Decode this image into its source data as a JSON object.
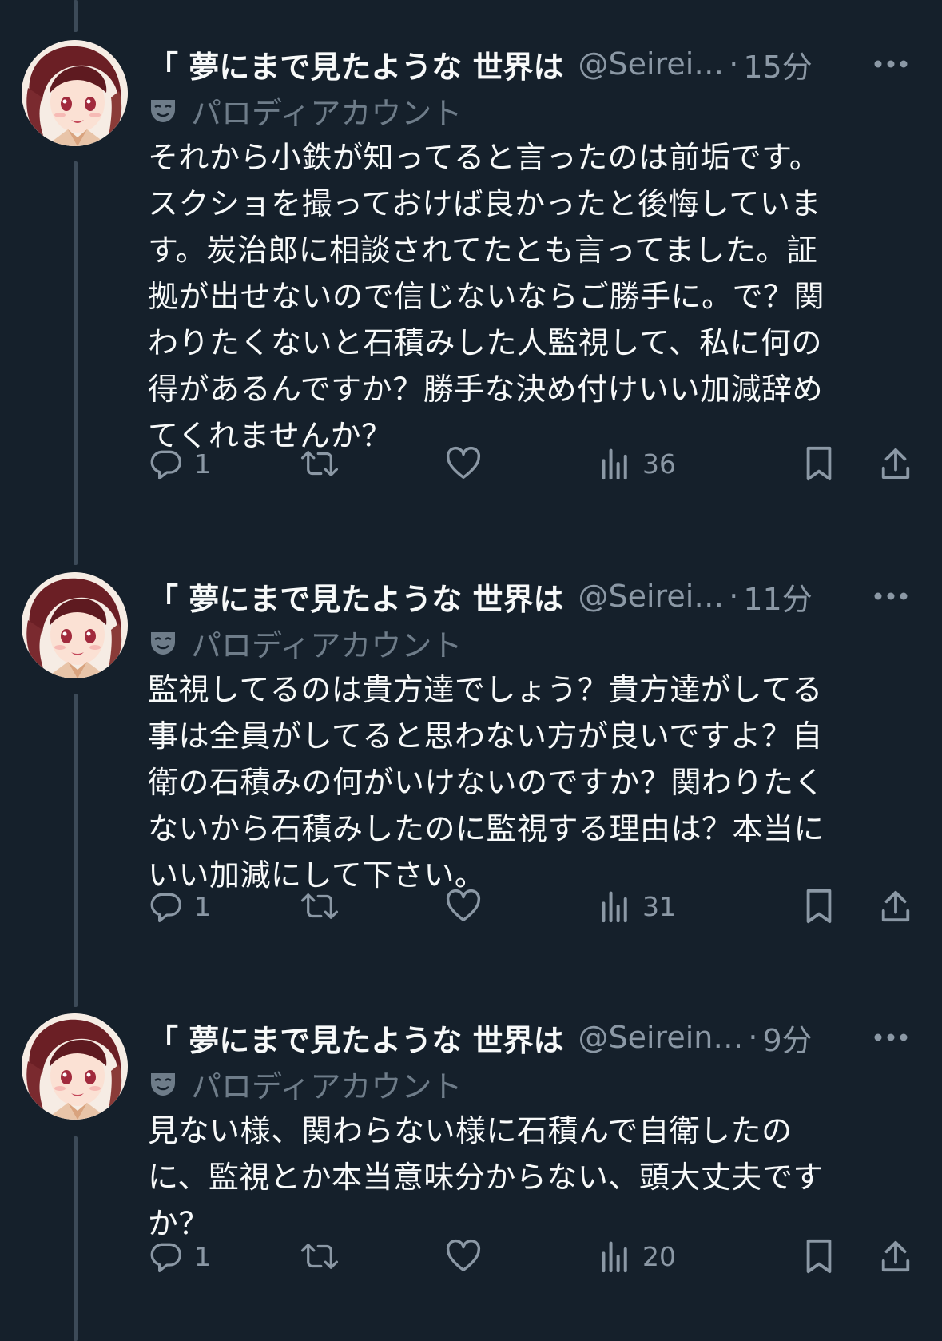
{
  "colors": {
    "background": "#15202b",
    "text_primary": "#f7f9f9",
    "text_secondary": "#8b98a5",
    "thread_line": "#3c4a58"
  },
  "tweets": [
    {
      "name": "「 夢にまで見たような 世界は",
      "handle": "@Seirei…",
      "sep": "·",
      "time": "15分",
      "label": "パロディアカウント",
      "text": "それから小鉄が知ってると言ったのは前垢です。\nスクショを撮っておけば良かったと後悔していま\nす。炭治郎に相談されてたとも言ってました。証\n拠が出せないので信じないならご勝手に。で？関\nわりたくないと石積みした人監視して、私に何の\n得があるんですか？勝手な決め付けいい加減辞め\nてくれませんか？",
      "replies": "1",
      "views": "36"
    },
    {
      "name": "「 夢にまで見たような 世界は",
      "handle": "@Seirei…",
      "sep": "·",
      "time": "11分",
      "label": "パロディアカウント",
      "text": "監視してるのは貴方達でしょう？貴方達がしてる\n事は全員がしてると思わない方が良いですよ？自\n衛の石積みの何がいけないのですか？関わりたく\nないから石積みしたのに監視する理由は？本当に\nいい加減にして下さい。",
      "replies": "1",
      "views": "31"
    },
    {
      "name": "「 夢にまで見たような 世界は",
      "handle": "@Seirein…",
      "sep": "·",
      "time": "9分",
      "label": "パロディアカウント",
      "text": "見ない様、関わらない様に石積んで自衛したの\nに、監視とか本当意味分からない、頭大丈夫です\nか？",
      "replies": "1",
      "views": "20"
    }
  ],
  "icons": {
    "reply": "reply-icon",
    "retweet": "retweet-icon",
    "like": "heart-icon",
    "views": "views-icon",
    "bookmark": "bookmark-icon",
    "share": "share-icon",
    "more": "more-icon",
    "parody": "mask-icon"
  }
}
